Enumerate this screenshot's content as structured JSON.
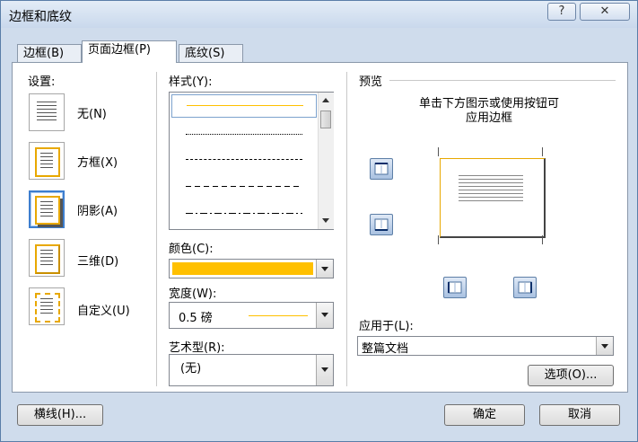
{
  "window": {
    "title": "边框和底纹",
    "help_label": "?",
    "close_label": "✕"
  },
  "tabs": [
    {
      "label": "边框(B)"
    },
    {
      "label": "页面边框(P)"
    },
    {
      "label": "底纹(S)"
    }
  ],
  "settings": {
    "header": "设置:",
    "items": [
      {
        "label": "无(N)"
      },
      {
        "label": "方框(X)"
      },
      {
        "label": "阴影(A)"
      },
      {
        "label": "三维(D)"
      },
      {
        "label": "自定义(U)"
      }
    ]
  },
  "style": {
    "header": "样式(Y):"
  },
  "color": {
    "label": "颜色(C):",
    "value_color": "#ffc000"
  },
  "width": {
    "label": "宽度(W):",
    "value": "0.5 磅"
  },
  "art": {
    "label": "艺术型(R):",
    "value": "(无)"
  },
  "preview": {
    "header": "预览",
    "hint_line1": "单击下方图示或使用按钮可",
    "hint_line2": "应用边框",
    "apply_label": "应用于(L):",
    "apply_value": "整篇文档",
    "options_button": "选项(O)..."
  },
  "footer": {
    "horizontal_line_button": "横线(H)...",
    "ok_button": "确定",
    "cancel_button": "取消"
  },
  "colors": {
    "accent": "#ffc000",
    "selection": "#3d7ecf"
  }
}
